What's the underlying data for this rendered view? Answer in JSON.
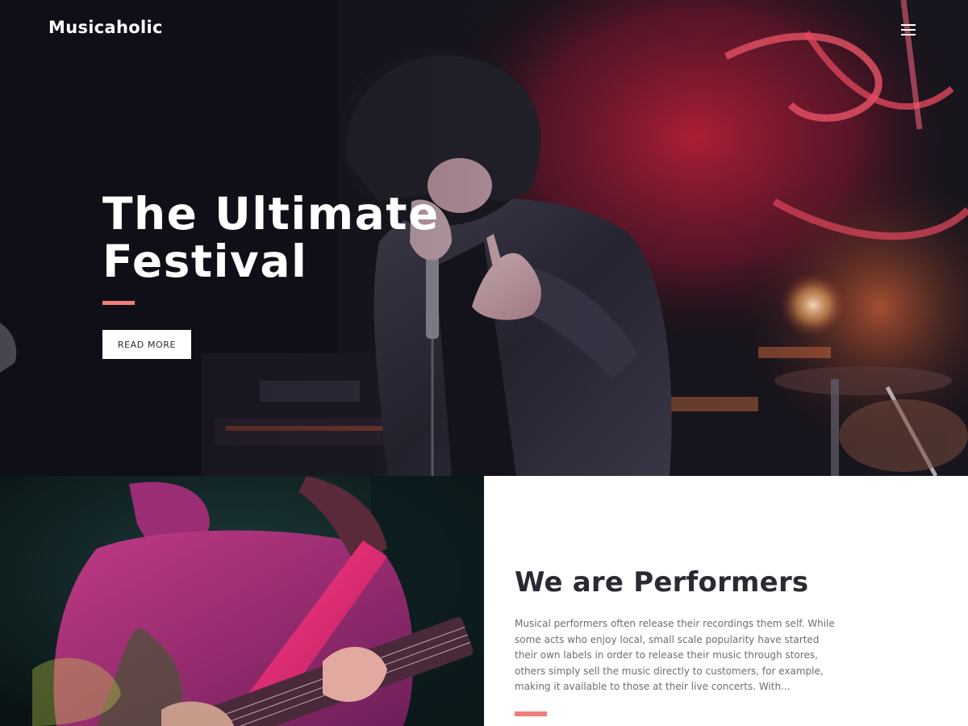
{
  "header": {
    "logo": "Musicaholic",
    "menu_icon": "hamburger-menu-icon"
  },
  "hero": {
    "title_line1": "The Ultimate",
    "title_line2": "Festival",
    "button_label": "READ MORE",
    "image": "singer-performing-on-stage-photo"
  },
  "about": {
    "heading": "We are Performers",
    "text": "Musical performers often release their recordings them self. While some acts who enjoy local, small scale popularity have started their own labels in order to release their music through stores, others simply sell the music directly to customers, for example, making it available to those at their live concerts. With...",
    "image": "guitarist-playing-photo"
  },
  "colors": {
    "accent": "#f17d7a",
    "heading": "#2b2a33",
    "body_text": "#6d6d75"
  }
}
